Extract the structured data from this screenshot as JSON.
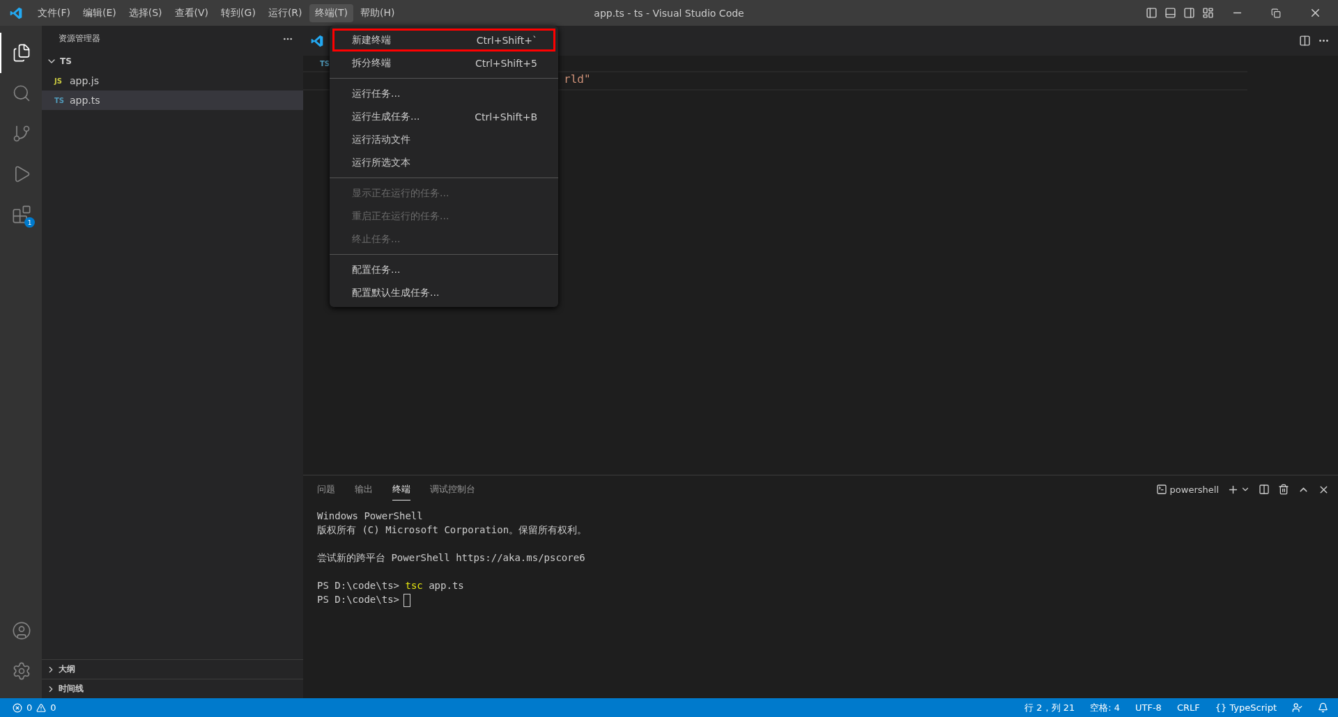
{
  "title_bar": {
    "menus": [
      {
        "label": "文件(F)",
        "selected": false
      },
      {
        "label": "编辑(E)",
        "selected": false
      },
      {
        "label": "选择(S)",
        "selected": false
      },
      {
        "label": "查看(V)",
        "selected": false
      },
      {
        "label": "转到(G)",
        "selected": false
      },
      {
        "label": "运行(R)",
        "selected": false
      },
      {
        "label": "终端(T)",
        "selected": true
      },
      {
        "label": "帮助(H)",
        "selected": false
      }
    ],
    "title": "app.ts - ts - Visual Studio Code"
  },
  "activity_bar": {
    "items": [
      {
        "kind": "explorer",
        "selected": true
      },
      {
        "kind": "search",
        "selected": false
      },
      {
        "kind": "source-control",
        "selected": false
      },
      {
        "kind": "run",
        "selected": false
      },
      {
        "kind": "extensions",
        "selected": false,
        "badge": "1"
      }
    ],
    "bottom": [
      {
        "kind": "account"
      },
      {
        "kind": "settings"
      }
    ]
  },
  "sidebar": {
    "title": "资源管理器",
    "folder": {
      "label": "TS",
      "expanded": true,
      "children": [
        {
          "label": "app.js",
          "badge": "JS",
          "color": "#cbcb41",
          "selected": false
        },
        {
          "label": "app.ts",
          "badge": "TS",
          "color": "#519aba",
          "selected": true
        }
      ]
    },
    "sections": [
      {
        "label": "大纲",
        "expanded": false
      },
      {
        "label": "时间线",
        "expanded": false
      }
    ]
  },
  "editor": {
    "breadcrumb": "TS",
    "code_fragment": "rld\""
  },
  "menu": {
    "items": [
      {
        "kind": "item",
        "label": "新建终端",
        "shortcut": "Ctrl+Shift+`",
        "disabled": false,
        "highlighted": true
      },
      {
        "kind": "item",
        "label": "拆分终端",
        "shortcut": "Ctrl+Shift+5",
        "disabled": false,
        "highlighted": false
      },
      {
        "kind": "separator"
      },
      {
        "kind": "item",
        "label": "运行任务...",
        "disabled": false,
        "highlighted": false
      },
      {
        "kind": "item",
        "label": "运行生成任务...",
        "shortcut": "Ctrl+Shift+B",
        "disabled": false,
        "highlighted": false
      },
      {
        "kind": "item",
        "label": "运行活动文件",
        "disabled": false,
        "highlighted": false
      },
      {
        "kind": "item",
        "label": "运行所选文本",
        "disabled": false,
        "highlighted": false
      },
      {
        "kind": "separator"
      },
      {
        "kind": "item",
        "label": "显示正在运行的任务...",
        "disabled": true,
        "highlighted": false
      },
      {
        "kind": "item",
        "label": "重启正在运行的任务...",
        "disabled": true,
        "highlighted": false
      },
      {
        "kind": "item",
        "label": "终止任务...",
        "disabled": true,
        "highlighted": false
      },
      {
        "kind": "separator"
      },
      {
        "kind": "item",
        "label": "配置任务...",
        "disabled": false,
        "highlighted": false
      },
      {
        "kind": "item",
        "label": "配置默认生成任务...",
        "disabled": false,
        "highlighted": false
      }
    ]
  },
  "panel": {
    "tabs": [
      {
        "label": "问题",
        "selected": false
      },
      {
        "label": "输出",
        "selected": false
      },
      {
        "label": "终端",
        "selected": true
      },
      {
        "label": "调试控制台",
        "selected": false
      }
    ],
    "terminal_name": "powershell",
    "lines": [
      {
        "kind": "text",
        "text": "Windows PowerShell"
      },
      {
        "kind": "text",
        "text": "版权所有 (C) Microsoft Corporation。保留所有权利。"
      },
      {
        "kind": "blank"
      },
      {
        "kind": "text",
        "text": "尝试新的跨平台 PowerShell https://aka.ms/pscore6"
      },
      {
        "kind": "blank"
      },
      {
        "kind": "command",
        "prompt": "PS D:\\code\\ts>",
        "command": "tsc",
        "args": "app.ts"
      },
      {
        "kind": "prompt",
        "prompt": "PS D:\\code\\ts>",
        "cursor": true
      }
    ]
  },
  "status_bar": {
    "errors": "0",
    "warnings": "0",
    "items": [
      "行 2，列 21",
      "空格: 4",
      "UTF-8",
      "CRLF",
      "{} TypeScript"
    ]
  }
}
